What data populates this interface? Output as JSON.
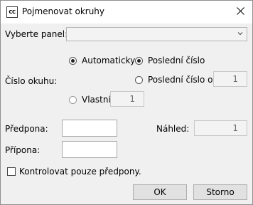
{
  "window": {
    "title": "Pojmenovat okruhy",
    "app_icon_text": "CC"
  },
  "panel": {
    "label": "Vyberte panel:",
    "selected_value": ""
  },
  "circuit_number": {
    "label": "Číslo okuhu:",
    "options": {
      "automatic": {
        "label": "Automaticky",
        "checked": true
      },
      "last_number": {
        "label": "Poslední číslo",
        "checked": true
      },
      "last_number_from": {
        "label": "Poslední číslo od",
        "checked": false,
        "value": "1"
      },
      "custom": {
        "label": "Vlastní",
        "checked": false,
        "value": "1"
      }
    }
  },
  "prefix": {
    "label": "Předpona:",
    "value": ""
  },
  "suffix": {
    "label": "Přípona:",
    "value": ""
  },
  "preview": {
    "label": "Náhled:",
    "value": "1"
  },
  "check_prefix_only": {
    "label": "Kontrolovat pouze předpony.",
    "checked": false
  },
  "buttons": {
    "ok": "OK",
    "cancel": "Storno"
  }
}
